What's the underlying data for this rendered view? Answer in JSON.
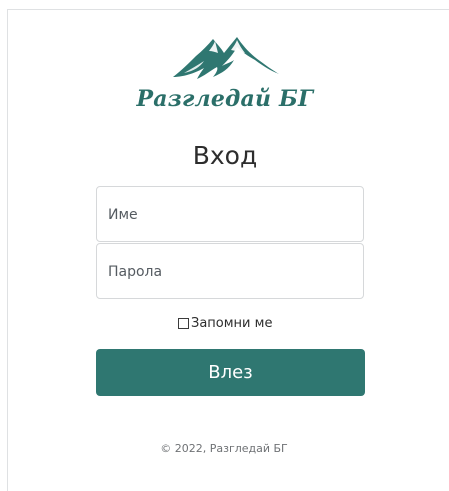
{
  "brand": {
    "name": "Разгледай БГ",
    "logo_icon": "mountain-logo-icon",
    "accent_color": "#2f7771"
  },
  "page": {
    "title": "Вход"
  },
  "form": {
    "username_placeholder": "Име",
    "password_placeholder": "Парола",
    "remember_label": "Запомни ме",
    "remember_checked": false,
    "submit_label": "Влез"
  },
  "footer": {
    "text": "© 2022, Разгледай БГ"
  }
}
